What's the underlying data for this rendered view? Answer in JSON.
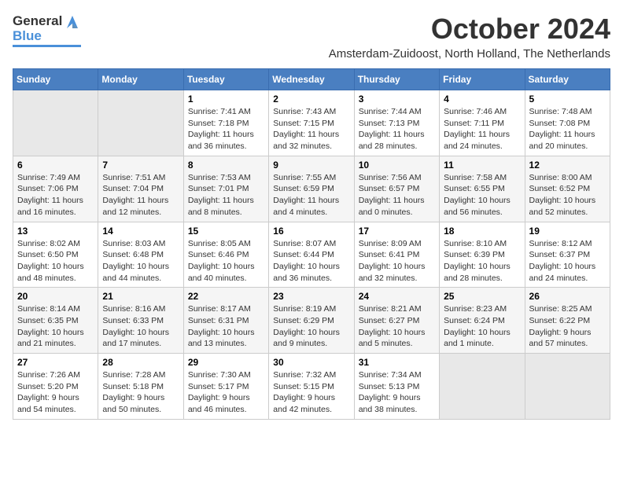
{
  "logo": {
    "line1": "General",
    "line2": "Blue"
  },
  "title": "October 2024",
  "location": "Amsterdam-Zuidoost, North Holland, The Netherlands",
  "days_header": [
    "Sunday",
    "Monday",
    "Tuesday",
    "Wednesday",
    "Thursday",
    "Friday",
    "Saturday"
  ],
  "weeks": [
    [
      {
        "day": "",
        "info": ""
      },
      {
        "day": "",
        "info": ""
      },
      {
        "day": "1",
        "info": "Sunrise: 7:41 AM\nSunset: 7:18 PM\nDaylight: 11 hours and 36 minutes."
      },
      {
        "day": "2",
        "info": "Sunrise: 7:43 AM\nSunset: 7:15 PM\nDaylight: 11 hours and 32 minutes."
      },
      {
        "day": "3",
        "info": "Sunrise: 7:44 AM\nSunset: 7:13 PM\nDaylight: 11 hours and 28 minutes."
      },
      {
        "day": "4",
        "info": "Sunrise: 7:46 AM\nSunset: 7:11 PM\nDaylight: 11 hours and 24 minutes."
      },
      {
        "day": "5",
        "info": "Sunrise: 7:48 AM\nSunset: 7:08 PM\nDaylight: 11 hours and 20 minutes."
      }
    ],
    [
      {
        "day": "6",
        "info": "Sunrise: 7:49 AM\nSunset: 7:06 PM\nDaylight: 11 hours and 16 minutes."
      },
      {
        "day": "7",
        "info": "Sunrise: 7:51 AM\nSunset: 7:04 PM\nDaylight: 11 hours and 12 minutes."
      },
      {
        "day": "8",
        "info": "Sunrise: 7:53 AM\nSunset: 7:01 PM\nDaylight: 11 hours and 8 minutes."
      },
      {
        "day": "9",
        "info": "Sunrise: 7:55 AM\nSunset: 6:59 PM\nDaylight: 11 hours and 4 minutes."
      },
      {
        "day": "10",
        "info": "Sunrise: 7:56 AM\nSunset: 6:57 PM\nDaylight: 11 hours and 0 minutes."
      },
      {
        "day": "11",
        "info": "Sunrise: 7:58 AM\nSunset: 6:55 PM\nDaylight: 10 hours and 56 minutes."
      },
      {
        "day": "12",
        "info": "Sunrise: 8:00 AM\nSunset: 6:52 PM\nDaylight: 10 hours and 52 minutes."
      }
    ],
    [
      {
        "day": "13",
        "info": "Sunrise: 8:02 AM\nSunset: 6:50 PM\nDaylight: 10 hours and 48 minutes."
      },
      {
        "day": "14",
        "info": "Sunrise: 8:03 AM\nSunset: 6:48 PM\nDaylight: 10 hours and 44 minutes."
      },
      {
        "day": "15",
        "info": "Sunrise: 8:05 AM\nSunset: 6:46 PM\nDaylight: 10 hours and 40 minutes."
      },
      {
        "day": "16",
        "info": "Sunrise: 8:07 AM\nSunset: 6:44 PM\nDaylight: 10 hours and 36 minutes."
      },
      {
        "day": "17",
        "info": "Sunrise: 8:09 AM\nSunset: 6:41 PM\nDaylight: 10 hours and 32 minutes."
      },
      {
        "day": "18",
        "info": "Sunrise: 8:10 AM\nSunset: 6:39 PM\nDaylight: 10 hours and 28 minutes."
      },
      {
        "day": "19",
        "info": "Sunrise: 8:12 AM\nSunset: 6:37 PM\nDaylight: 10 hours and 24 minutes."
      }
    ],
    [
      {
        "day": "20",
        "info": "Sunrise: 8:14 AM\nSunset: 6:35 PM\nDaylight: 10 hours and 21 minutes."
      },
      {
        "day": "21",
        "info": "Sunrise: 8:16 AM\nSunset: 6:33 PM\nDaylight: 10 hours and 17 minutes."
      },
      {
        "day": "22",
        "info": "Sunrise: 8:17 AM\nSunset: 6:31 PM\nDaylight: 10 hours and 13 minutes."
      },
      {
        "day": "23",
        "info": "Sunrise: 8:19 AM\nSunset: 6:29 PM\nDaylight: 10 hours and 9 minutes."
      },
      {
        "day": "24",
        "info": "Sunrise: 8:21 AM\nSunset: 6:27 PM\nDaylight: 10 hours and 5 minutes."
      },
      {
        "day": "25",
        "info": "Sunrise: 8:23 AM\nSunset: 6:24 PM\nDaylight: 10 hours and 1 minute."
      },
      {
        "day": "26",
        "info": "Sunrise: 8:25 AM\nSunset: 6:22 PM\nDaylight: 9 hours and 57 minutes."
      }
    ],
    [
      {
        "day": "27",
        "info": "Sunrise: 7:26 AM\nSunset: 5:20 PM\nDaylight: 9 hours and 54 minutes."
      },
      {
        "day": "28",
        "info": "Sunrise: 7:28 AM\nSunset: 5:18 PM\nDaylight: 9 hours and 50 minutes."
      },
      {
        "day": "29",
        "info": "Sunrise: 7:30 AM\nSunset: 5:17 PM\nDaylight: 9 hours and 46 minutes."
      },
      {
        "day": "30",
        "info": "Sunrise: 7:32 AM\nSunset: 5:15 PM\nDaylight: 9 hours and 42 minutes."
      },
      {
        "day": "31",
        "info": "Sunrise: 7:34 AM\nSunset: 5:13 PM\nDaylight: 9 hours and 38 minutes."
      },
      {
        "day": "",
        "info": ""
      },
      {
        "day": "",
        "info": ""
      }
    ]
  ]
}
